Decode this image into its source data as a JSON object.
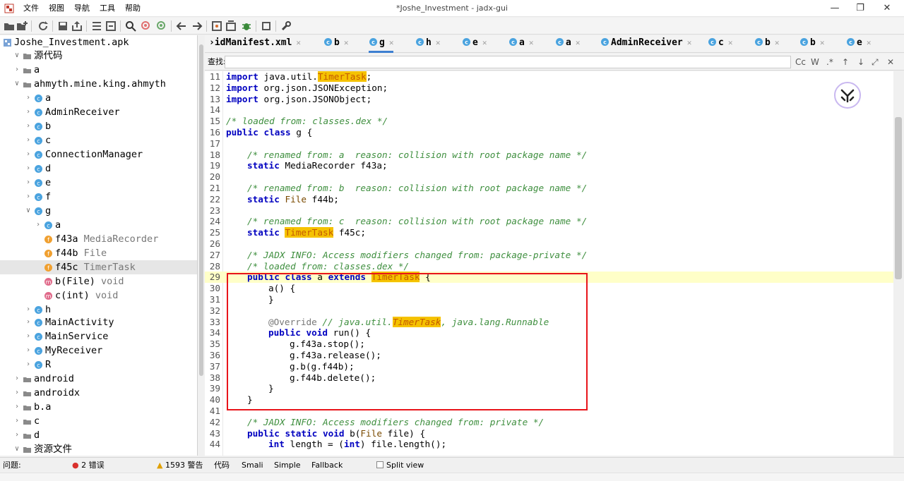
{
  "window": {
    "title": "*Joshe_Investment - jadx-gui"
  },
  "menu": [
    "文件",
    "视图",
    "导航",
    "工具",
    "帮助"
  ],
  "tree": [
    {
      "label": "Joshe_Investment.apk"
    },
    {
      "label": "源代码"
    },
    {
      "label": "a"
    },
    {
      "label": "ahmyth.mine.king.ahmyth"
    },
    {
      "label": "a"
    },
    {
      "label": "AdminReceiver"
    },
    {
      "label": "b"
    },
    {
      "label": "c"
    },
    {
      "label": "ConnectionManager"
    },
    {
      "label": "d"
    },
    {
      "label": "e"
    },
    {
      "label": "f"
    },
    {
      "label": "g"
    },
    {
      "label": "a"
    },
    {
      "label": "f43a",
      "type": "MediaRecorder"
    },
    {
      "label": "f44b",
      "type": "File"
    },
    {
      "label": "f45c",
      "type": "TimerTask"
    },
    {
      "label": "b(File)",
      "type": "void"
    },
    {
      "label": "c(int)",
      "type": "void"
    },
    {
      "label": "h"
    },
    {
      "label": "MainActivity"
    },
    {
      "label": "MainService"
    },
    {
      "label": "MyReceiver"
    },
    {
      "label": "R"
    },
    {
      "label": "android"
    },
    {
      "label": "androidx"
    },
    {
      "label": "b.a"
    },
    {
      "label": "c"
    },
    {
      "label": "d"
    },
    {
      "label": "资源文件"
    }
  ],
  "tabs": [
    {
      "label": "›idManifest.xml"
    },
    {
      "label": "b"
    },
    {
      "label": "g"
    },
    {
      "label": "h"
    },
    {
      "label": "e"
    },
    {
      "label": "a"
    },
    {
      "label": "a"
    },
    {
      "label": "AdminReceiver"
    },
    {
      "label": "c"
    },
    {
      "label": "b"
    },
    {
      "label": "b"
    },
    {
      "label": "e"
    }
  ],
  "search": {
    "label": "查找:",
    "value": "",
    "options": [
      "Cc",
      "W",
      ".*",
      "↑",
      "↓",
      "⤢",
      "✕"
    ]
  },
  "code": {
    "line_numbers": [
      "11",
      "12",
      "13",
      "14",
      "15",
      "16",
      "17",
      "18",
      "19",
      "20",
      "21",
      "22",
      "23",
      "24",
      "25",
      "26",
      "27",
      "28",
      "29",
      "30",
      "31",
      "32",
      "33",
      "34",
      "35",
      "36",
      "37",
      "38",
      "39",
      "40",
      "41",
      "42",
      "43",
      "44"
    ],
    "l11": {
      "a": "import",
      "b": " java.util.",
      "c": "TimerTask",
      "d": ";"
    },
    "l12": {
      "a": "import",
      "b": " org.json.JSONException;"
    },
    "l13": {
      "a": "import",
      "b": " org.json.JSONObject;"
    },
    "l15": "/* loaded from: classes.dex */",
    "l16": {
      "a": "public class",
      "b": " g {"
    },
    "l18": "/* renamed from: a  reason: collision with root package name */",
    "l19": {
      "a": "static",
      "b": " MediaRecorder f43a;"
    },
    "l21": "/* renamed from: b  reason: collision with root package name */",
    "l22": {
      "a": "static",
      "b": "File",
      "c": " f44b;"
    },
    "l24": "/* renamed from: c  reason: collision with root package name */",
    "l25": {
      "a": "static",
      "b": "TimerTask",
      "c": " f45c;"
    },
    "l27": "/* JADX INFO: Access modifiers changed from: package-private */",
    "l28": "/* loaded from: classes.dex */",
    "l29": {
      "a": "public class",
      "b": " a ",
      "c": "extends",
      "d": "TimerTask",
      "e": " {"
    },
    "l30": "a() {",
    "l31": "}",
    "l33": {
      "a": "@Override",
      "b": " // java.util.",
      "c": "TimerTask",
      "d": ", java.lang.Runnable"
    },
    "l34": {
      "a": "public void",
      "b": " run() {"
    },
    "l35": "g.f43a.stop();",
    "l36": "g.f43a.release();",
    "l37": "g.b(g.f44b);",
    "l38": "g.f44b.delete();",
    "l39": "}",
    "l40": "}",
    "l42": "/* JADX INFO: Access modifiers changed from: private */",
    "l43": {
      "a": "public static void",
      "b": " b(",
      "c": "File",
      "d": " file) {"
    },
    "l44": {
      "a": "int",
      "b": " length = (",
      "c": "int",
      "d": ") file.length();"
    }
  },
  "status": {
    "problems": "问题:",
    "errors": "2 错误",
    "warnings": "1593 警告",
    "views": [
      "代码",
      "Smali",
      "Simple",
      "Fallback"
    ],
    "split_view": "Split view"
  },
  "colors": {
    "accent": "#3d7fd1",
    "highlight": "#f5c200",
    "annotation_box": "#e8141a",
    "keyword": "#0000c0",
    "comment": "#3f8f3f"
  }
}
